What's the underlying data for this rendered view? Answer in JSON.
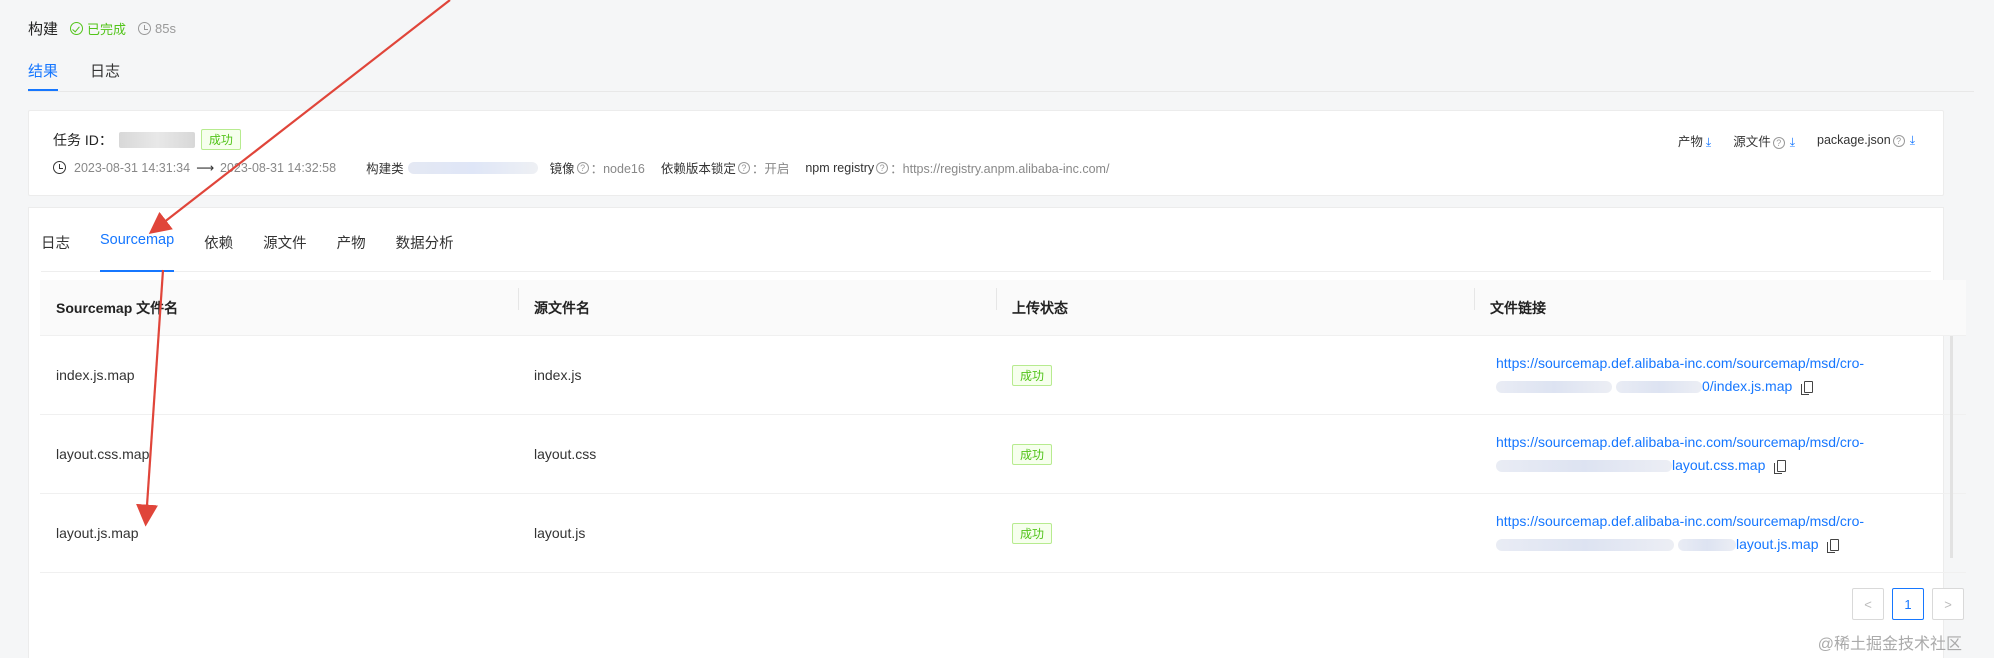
{
  "build": {
    "title": "构建",
    "status": "已完成",
    "duration": "85s",
    "status_color": "#52c41a"
  },
  "top_tabs": [
    {
      "label": "结果",
      "active": true
    },
    {
      "label": "日志",
      "active": false
    }
  ],
  "task": {
    "id_label": "任务 ID：",
    "status_tag": "成功",
    "time_start": "2023-08-31 14:31:34",
    "time_end": "2023-08-31 14:32:58",
    "build_type_label": "构建类",
    "image_label": "镜像",
    "image_value": "：node16",
    "lock_label": "依赖版本锁定",
    "lock_value": "：开启",
    "registry_label": "npm registry",
    "registry_value": "：https://registry.anpm.alibaba-inc.com/"
  },
  "downloads": [
    {
      "label": "产物",
      "has_help": false
    },
    {
      "label": "源文件",
      "has_help": true
    },
    {
      "label": "package.json",
      "has_help": true
    }
  ],
  "sub_tabs": [
    {
      "label": "日志",
      "active": false
    },
    {
      "label": "Sourcemap",
      "active": true
    },
    {
      "label": "依赖",
      "active": false
    },
    {
      "label": "源文件",
      "active": false
    },
    {
      "label": "产物",
      "active": false
    },
    {
      "label": "数据分析",
      "active": false
    }
  ],
  "table": {
    "headers": [
      "Sourcemap 文件名",
      "源文件名",
      "上传状态",
      "文件链接"
    ],
    "rows": [
      {
        "map": "index.js.map",
        "source": "index.js",
        "status": "成功",
        "link_line1": "https://sourcemap.def.alibaba-inc.com/sourcemap/msd/cro-",
        "link_line2": "0/index.js.map"
      },
      {
        "map": "layout.css.map",
        "source": "layout.css",
        "status": "成功",
        "link_line1": "https://sourcemap.def.alibaba-inc.com/sourcemap/msd/cro-",
        "link_line2": "layout.css.map"
      },
      {
        "map": "layout.js.map",
        "source": "layout.js",
        "status": "成功",
        "link_line1": "https://sourcemap.def.alibaba-inc.com/sourcemap/msd/cro-",
        "link_line2": "layout.js.map"
      }
    ]
  },
  "pagination": {
    "prev": "<",
    "current": "1",
    "next": ">"
  },
  "watermark": "@稀土掘金技术社区",
  "accent_color": "#1677ff",
  "annotation_color": "#e0453a"
}
